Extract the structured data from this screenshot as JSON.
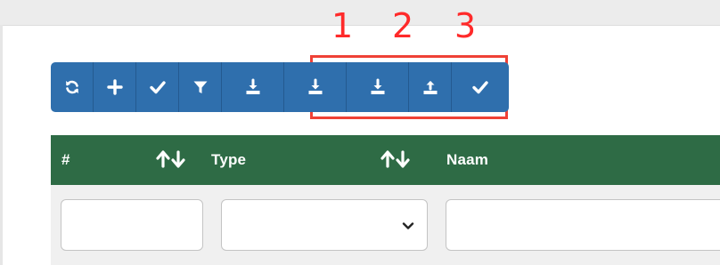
{
  "annotations": {
    "numbers": [
      "1",
      "2",
      "3"
    ],
    "color": "#ef4136"
  },
  "toolbar": {
    "buttons": [
      {
        "name": "refresh",
        "icon": "refresh-icon"
      },
      {
        "name": "add",
        "icon": "plus-icon"
      },
      {
        "name": "confirm",
        "icon": "check-icon"
      },
      {
        "name": "filter",
        "icon": "filter-icon"
      },
      {
        "name": "download-1",
        "icon": "download-icon"
      },
      {
        "name": "download-2",
        "icon": "download-icon"
      },
      {
        "name": "download-3",
        "icon": "download-icon"
      },
      {
        "name": "upload",
        "icon": "upload-icon"
      },
      {
        "name": "confirm-2",
        "icon": "check-icon"
      }
    ],
    "button_color": "#2f6fad"
  },
  "table": {
    "header_color": "#2e6b45",
    "columns": [
      {
        "label": "#"
      },
      {
        "label": "Type"
      },
      {
        "label": "Naam"
      }
    ],
    "filters": {
      "number_value": "",
      "type_selected": "",
      "name_value": ""
    }
  }
}
